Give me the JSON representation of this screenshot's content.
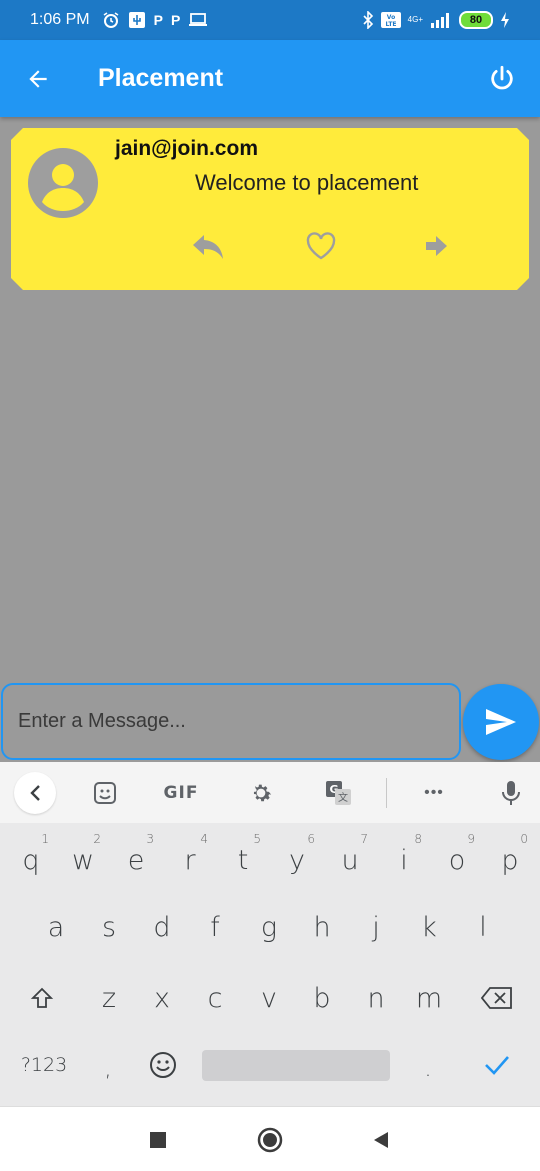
{
  "status_bar": {
    "time": "1:06 PM",
    "left_icons": [
      "alarm-icon",
      "usb-icon",
      "parking-icon",
      "parking-icon",
      "laptop-icon"
    ],
    "right_icons": [
      "bluetooth-icon",
      "volte-icon",
      "signal-icon",
      "battery-icon",
      "charging-icon"
    ],
    "network": "4G+",
    "battery": "80"
  },
  "app_bar": {
    "title": "Placement",
    "color": "#2196f3"
  },
  "message": {
    "sender": "jain@join.com",
    "text": "Welcome to placement",
    "card_color": "#ffeb3b",
    "actions": [
      "reply-icon",
      "heart-icon",
      "forward-icon"
    ]
  },
  "composer": {
    "placeholder": "Enter a Message...",
    "value": ""
  },
  "keyboard": {
    "toolbar": {
      "gif": "GIF",
      "more": "•••"
    },
    "row1": [
      "q",
      "w",
      "e",
      "r",
      "t",
      "y",
      "u",
      "i",
      "o",
      "p"
    ],
    "row1_hints": [
      "1",
      "2",
      "3",
      "4",
      "5",
      "6",
      "7",
      "8",
      "9",
      "0"
    ],
    "row2": [
      "a",
      "s",
      "d",
      "f",
      "g",
      "h",
      "j",
      "k",
      "l"
    ],
    "row3": [
      "z",
      "x",
      "c",
      "v",
      "b",
      "n",
      "m"
    ],
    "symbols_key": "?123",
    "comma_key": ",",
    "period_key": "."
  }
}
